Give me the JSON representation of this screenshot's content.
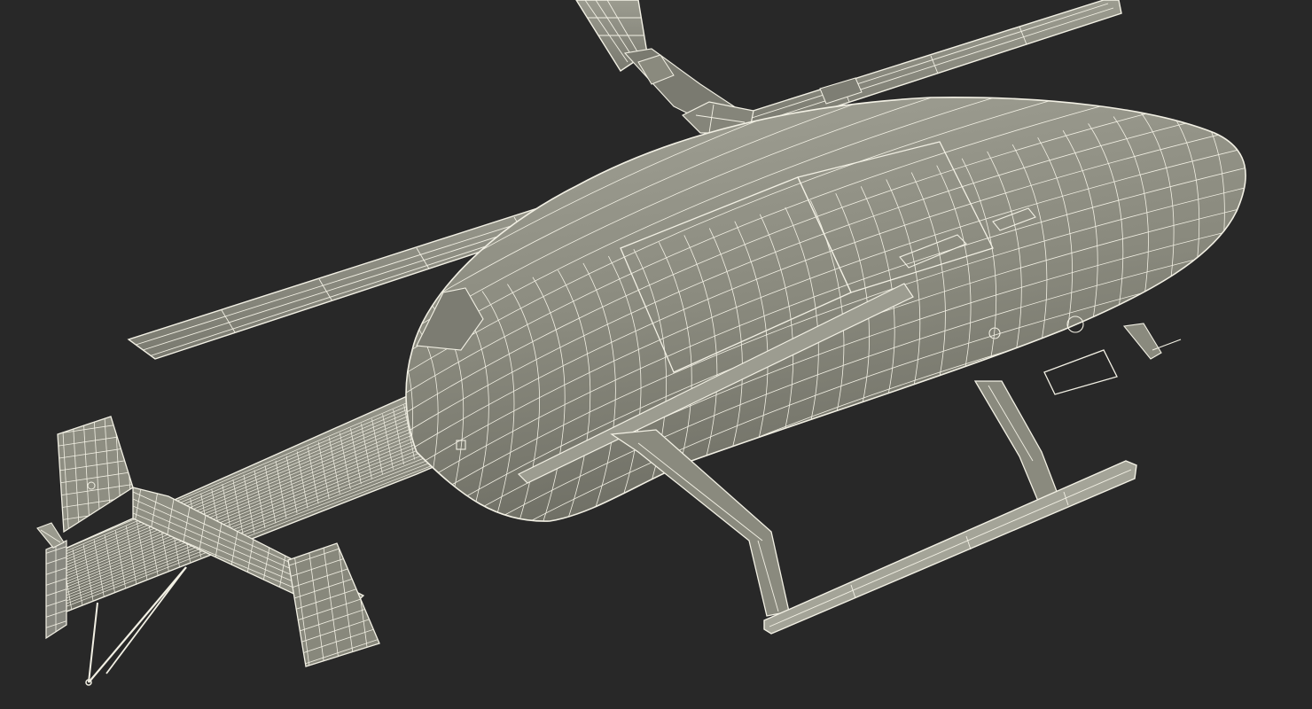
{
  "scene": {
    "subject": "helicopter-wireframe-model",
    "colors": {
      "background": "#282828",
      "surface": "#8c8c80",
      "surface_light": "#a6a69a",
      "surface_dark": "#6c6c62",
      "wire": "#f2f0e4",
      "shadow": "#5a5a52"
    }
  }
}
